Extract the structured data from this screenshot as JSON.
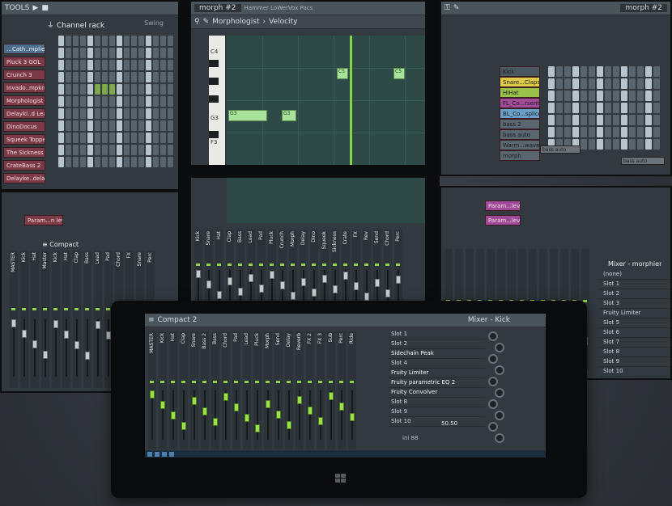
{
  "left_panel": {
    "menu_label": "TOOLS",
    "header_title": "Channel rack",
    "swing_label": "Swing",
    "channels": [
      {
        "name": "…Cath..mplier",
        "selected": true
      },
      {
        "name": "Pluck 3 GOL",
        "selected": false
      },
      {
        "name": "Crunch 3",
        "selected": false
      },
      {
        "name": "Invado..mpkrnl",
        "selected": false
      },
      {
        "name": "Morphologist",
        "selected": false
      },
      {
        "name": "Delayki..d Lead",
        "selected": false
      },
      {
        "name": "DinoDocus",
        "selected": false
      },
      {
        "name": "Squeek Topper",
        "selected": false
      },
      {
        "name": "The Sickness",
        "selected": false
      },
      {
        "name": "CrateBass 2",
        "selected": false
      },
      {
        "name": "Delayke..delay",
        "selected": false
      }
    ],
    "lower_button": "Param...n level",
    "mixer_title": "Compact",
    "mixer_labels": [
      "MASTER",
      "Kick",
      "Hat",
      "Master",
      "Kick",
      "Hat",
      "Clap",
      "Bass",
      "Lead",
      "Pad",
      "Chord",
      "FX",
      "Snare",
      "Perc"
    ]
  },
  "center_panel": {
    "pattern": "morph #2",
    "hint_text": "Hammer LoWerVox Pacs",
    "plugin": "Morphologist",
    "param": "Velocity",
    "keys": [
      "C4",
      "G3",
      "F3"
    ],
    "notes": [
      "C5",
      "C5",
      "G3",
      "G3"
    ],
    "track_labels": [
      "Kick",
      "Snare",
      "Hat",
      "Clap",
      "Bass",
      "Lead",
      "Pad",
      "Pluck",
      "Crunch",
      "Morph",
      "Delay",
      "Dino",
      "Squeek",
      "Sickness",
      "Crate",
      "FX",
      "Rev",
      "Send",
      "Chord",
      "Perc"
    ]
  },
  "right_panel": {
    "pattern": "morph #2",
    "tracks": [
      {
        "name": "Kick",
        "color": "#4a5660"
      },
      {
        "name": "Snare...Claps",
        "color": "#e0ca4a"
      },
      {
        "name": "HiHat",
        "color": "#9ac14c"
      },
      {
        "name": "FL_Co...rsent",
        "color": "#a04a9a"
      },
      {
        "name": "BL_Co...splice",
        "color": "#6aa0c8"
      },
      {
        "name": "bass 2",
        "color": "#5a6670"
      },
      {
        "name": "bass auto",
        "color": "#5a6670"
      },
      {
        "name": "Warm...waves",
        "color": "#5a6670"
      },
      {
        "name": "morph",
        "color": "#5a6670"
      }
    ],
    "clip_labels": [
      "bass auto",
      "bass auto"
    ],
    "params": [
      "Param...level",
      "Param...level"
    ]
  },
  "right_mixer": {
    "title": "Mixer - morphier",
    "slots": [
      "(none)",
      "Slot 1",
      "Slot 2",
      "Slot 3",
      "Fruity Limiter",
      "Slot 5",
      "Slot 6",
      "Slot 7",
      "Slot 8",
      "Slot 9",
      "Slot 10"
    ]
  },
  "tablet": {
    "mixer_title": "Compact 2",
    "insert_title": "Mixer - Kick",
    "strip_names": [
      "MASTER",
      "Kick",
      "Hat",
      "Clap",
      "Snare",
      "Bass 2",
      "Bass",
      "Chord",
      "Pad",
      "Lead",
      "Pluck",
      "Morph",
      "Send",
      "Delay",
      "Reverb",
      "FX 2",
      "FX 3",
      "Sub",
      "Perc",
      "Ride"
    ],
    "slots": [
      {
        "name": "Slot 1",
        "active": false
      },
      {
        "name": "Slot 2",
        "active": false
      },
      {
        "name": "Sidechain Peak",
        "active": true
      },
      {
        "name": "Slot 4",
        "active": false
      },
      {
        "name": "Fruity Limiter",
        "active": true
      },
      {
        "name": "Fruity parametric EQ 2",
        "active": true
      },
      {
        "name": "Fruity Convolver",
        "active": true
      },
      {
        "name": "Slot 8",
        "active": false
      },
      {
        "name": "Slot 9",
        "active": false
      },
      {
        "name": "Slot 10",
        "active": false
      }
    ],
    "eq_readout": "50.50",
    "eq_value": "ini 88"
  }
}
